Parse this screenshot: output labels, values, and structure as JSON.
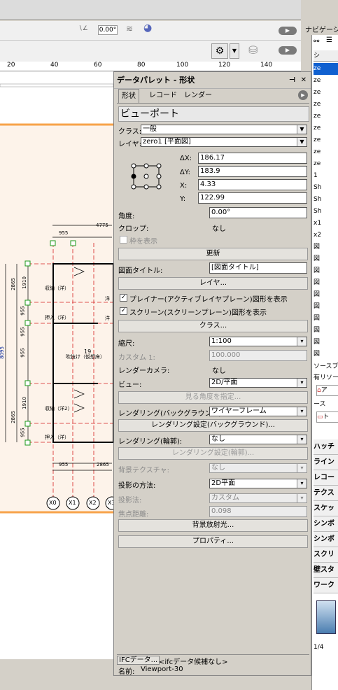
{
  "toolbar": {
    "angle_value": "0.00°",
    "nav_label": "ナビゲーシ"
  },
  "ruler": {
    "ticks": [
      "20",
      "40",
      "60",
      "80",
      "100",
      "120",
      "140"
    ]
  },
  "drawing": {
    "dims": {
      "top": "4775",
      "d955a": "955",
      "d2865a": "2865",
      "d1910a": "1910",
      "d955b": "955",
      "d8095": "8095",
      "d955c": "955",
      "d955d": "955",
      "d2865b": "2865",
      "d1910b": "1910",
      "d955e": "955",
      "bot955": "955",
      "bot2865": "2865"
    },
    "rooms": {
      "r1": "収納（洋）",
      "r2": "押入（洋）",
      "r3": "吹抜け（仮想床）",
      "r3num": "19",
      "r4": "収納（洋2）",
      "r5": "押入（洋）",
      "side1": "洋",
      "side2": "洋"
    },
    "grid": [
      "X0",
      "X1",
      "X2",
      "X3"
    ]
  },
  "palette": {
    "title": "データパレット - 形状",
    "tabs": [
      "形状",
      "レコード",
      "レンダー"
    ],
    "object_type": "ビューポート",
    "class_label": "クラス:",
    "class_value": "一般",
    "layer_label": "レイヤ:",
    "layer_value": "zero1 [平面図]",
    "dx_label": "ΔX:",
    "dx": "186.17",
    "dy_label": "ΔY:",
    "dy": "183.9",
    "x_label": "X:",
    "x": "4.33",
    "y_label": "Y:",
    "y": "122.99",
    "angle_label": "角度:",
    "angle": "0.00°",
    "crop_label": "クロップ:",
    "crop": "なし",
    "show_frame": "枠を表示",
    "update_btn": "更新",
    "drawing_title_label": "図面タイトル:",
    "drawing_title": "[図面タイトル]",
    "layer_btn": "レイヤ...",
    "planar_chk": "プレイナー(アクティブレイヤプレーン)図形を表示",
    "screen_chk": "スクリーン(スクリーンプレーン)図形を表示",
    "class_btn": "クラス...",
    "scale_label": "縮尺:",
    "scale": "1:100",
    "custom_label": "カスタム 1:",
    "custom": "100.000",
    "camera_label": "レンダーカメラ:",
    "camera": "なし",
    "view_label": "ビュー:",
    "view": "2D/平面",
    "view_angle_btn": "見る角度を指定...",
    "bg_render_label": "レンダリング(バックグラウンド):",
    "bg_render": "ワイヤーフレーム",
    "bg_render_settings": "レンダリング設定(バックグラウンド)...",
    "line_render_label": "レンダリング(輪郭):",
    "line_render": "なし",
    "line_render_settings": "レンダリング設定(輪郭)...",
    "bg_texture_label": "背景テクスチャ:",
    "bg_texture": "なし",
    "projection_label": "投影の方法:",
    "projection": "2D平面",
    "perspective_label": "投影法:",
    "perspective": "カスタム",
    "focal_label": "焦点距離:",
    "focal": "0.098",
    "bg_radiosity_btn": "背景放射光...",
    "properties_btn": "プロパティ...",
    "ifc_btn": "IFCデータ...",
    "ifc_status": "<ifcデータ候補なし>",
    "name_label": "名前:",
    "name": "Viewport-30"
  },
  "right_panel": {
    "header": "シ",
    "items": [
      "ze",
      "ze",
      "ze",
      "ze",
      "ze",
      "ze",
      "ze",
      "ze",
      "ze",
      "1",
      "Sh",
      "Sh",
      "Sh",
      "x1",
      "x2",
      "図",
      "図",
      "図",
      "図",
      "図",
      "図",
      "図",
      "図",
      "図",
      "図"
    ],
    "section1": "ソースブ",
    "section2": "有リソー",
    "res1": "ア",
    "section3": "ース",
    "res2": "ト",
    "tools": [
      "ハッチ",
      "ライン",
      "レコー",
      "テクス",
      "スケッ",
      "シンボ",
      "シンボ",
      "スクリ",
      "壁スタ",
      "ワーク"
    ],
    "pager": "1/4"
  },
  "colors": {
    "accent_orange": "#f7a34a",
    "grid_red": "#d52020",
    "highlight_blue": "#1060d0"
  }
}
